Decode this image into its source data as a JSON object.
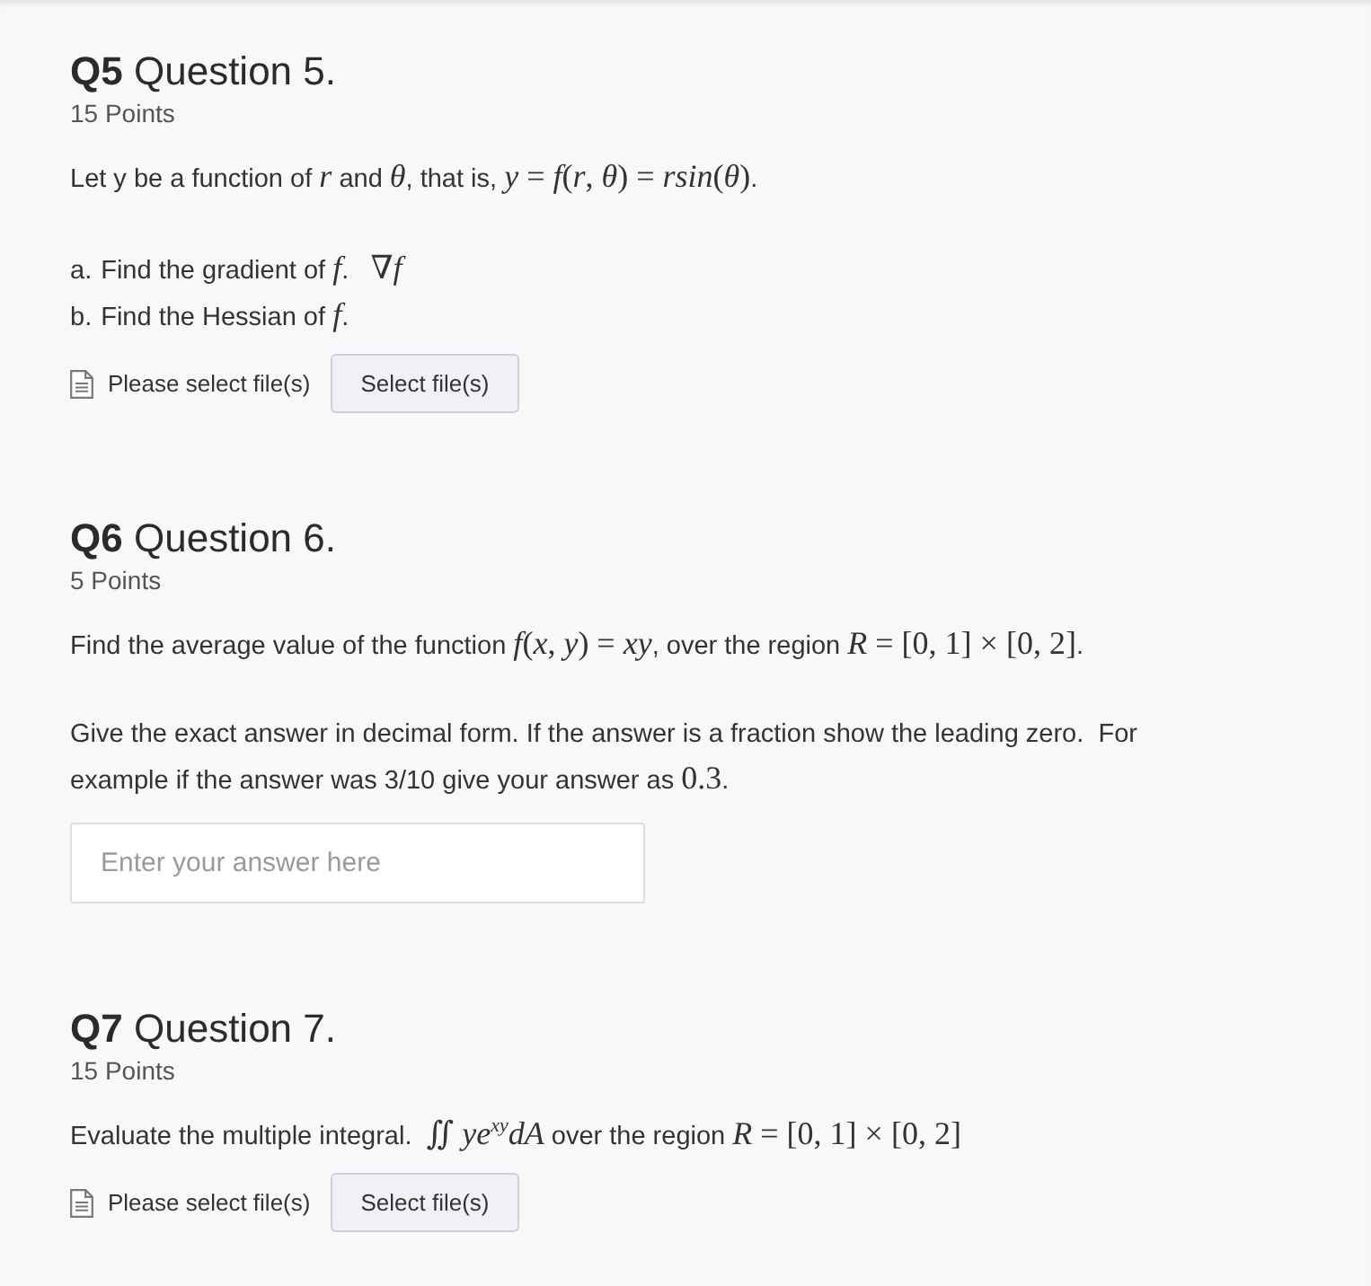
{
  "questions": [
    {
      "number": "Q5",
      "title": "Question 5.",
      "points": "15 Points",
      "body": [
        {
          "kind": "paragraph",
          "parts": [
            {
              "kind": "text",
              "text": "Let y be a function of "
            },
            {
              "kind": "math",
              "text": "*r*"
            },
            {
              "kind": "text",
              "text": " and "
            },
            {
              "kind": "math",
              "text": "*θ*"
            },
            {
              "kind": "text",
              "text": ", that is, "
            },
            {
              "kind": "math",
              "text": "*y* = *f*(*r*, *θ*) = *rsin*(*θ*)"
            },
            {
              "kind": "text",
              "text": "."
            }
          ]
        },
        {
          "kind": "list",
          "items": [
            {
              "marker": "a.",
              "parts": [
                {
                  "kind": "text",
                  "text": "Find the gradient of "
                },
                {
                  "kind": "math",
                  "text": "*f*"
                },
                {
                  "kind": "text",
                  "text": ".   "
                },
                {
                  "kind": "math",
                  "text": "∇*f*"
                }
              ]
            },
            {
              "marker": "b.",
              "parts": [
                {
                  "kind": "text",
                  "text": "Find the Hessian of "
                },
                {
                  "kind": "math",
                  "text": "*f*"
                },
                {
                  "kind": "text",
                  "text": "."
                }
              ]
            }
          ]
        }
      ],
      "response": {
        "kind": "file",
        "status": "Please select file(s)",
        "button": "Select file(s)"
      }
    },
    {
      "number": "Q6",
      "title": "Question 6.",
      "points": "5 Points",
      "body": [
        {
          "kind": "paragraph",
          "parts": [
            {
              "kind": "text",
              "text": "Find the average value of the function "
            },
            {
              "kind": "math",
              "text": "*f*(*x*, *y*) = *xy*"
            },
            {
              "kind": "text",
              "text": ", over the region "
            },
            {
              "kind": "math",
              "text": "*R* = [0, 1] × [0, 2]"
            },
            {
              "kind": "text",
              "text": "."
            }
          ]
        },
        {
          "kind": "paragraph",
          "parts": [
            {
              "kind": "text",
              "text": "Give the exact answer in decimal form. If the answer is a fraction show the leading zero.  For example if the answer was 3/10 give your answer as "
            },
            {
              "kind": "math",
              "text": "0.3"
            },
            {
              "kind": "text",
              "text": "."
            }
          ]
        }
      ],
      "response": {
        "kind": "text",
        "placeholder": "Enter your answer here"
      }
    },
    {
      "number": "Q7",
      "title": "Question 7.",
      "points": "15 Points",
      "body": [
        {
          "kind": "paragraph",
          "parts": [
            {
              "kind": "text",
              "text": "Evaluate the multiple integral.  "
            },
            {
              "kind": "math",
              "text": "∬ *ye*$^{xy}$*dA*"
            },
            {
              "kind": "text",
              "text": " over the region "
            },
            {
              "kind": "math",
              "text": "*R* = [0, 1] × [0, 2]"
            }
          ]
        }
      ],
      "response": {
        "kind": "file",
        "status": "Please select file(s)",
        "button": "Select file(s)"
      }
    }
  ]
}
